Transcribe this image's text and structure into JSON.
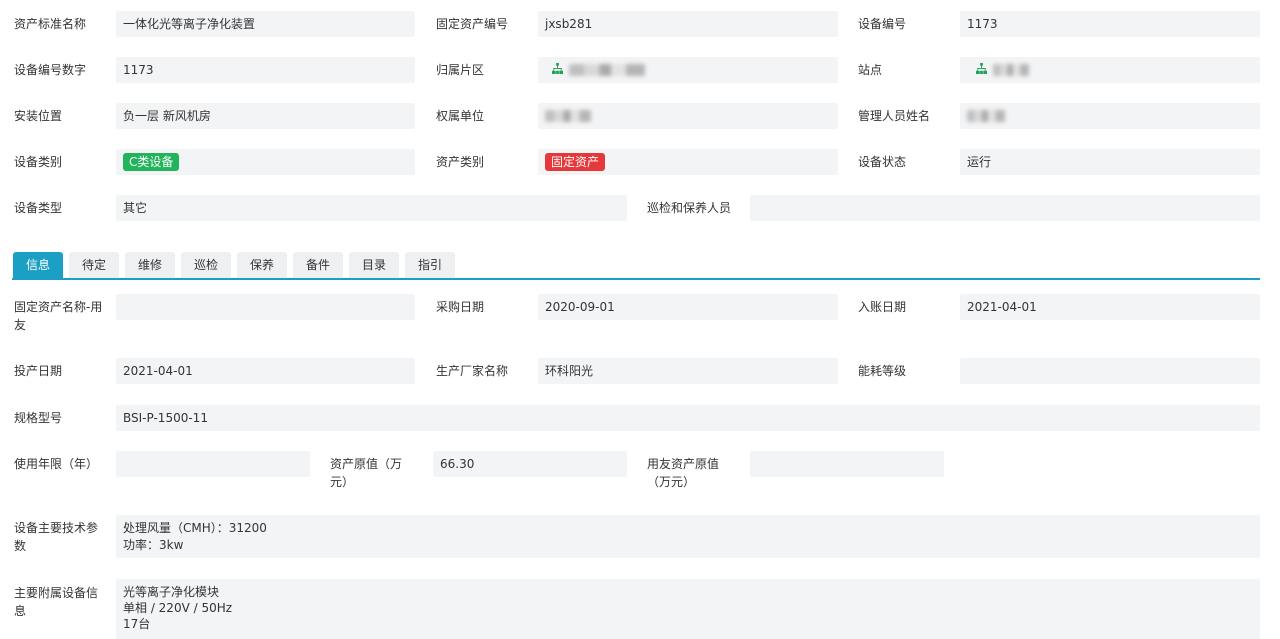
{
  "fields_top": {
    "asset_std_name_label": "资产标准名称",
    "asset_std_name": "一体化光等离子净化装置",
    "fixed_asset_no_label": "固定资产编号",
    "fixed_asset_no": "jxsb281",
    "device_no_label": "设备编号",
    "device_no": "1173",
    "device_no_num_label": "设备编号数字",
    "device_no_num": "1173",
    "area_label": "归属片区",
    "site_label": "站点",
    "install_loc_label": "安装位置",
    "install_loc": "负一层 新风机房",
    "owner_unit_label": "权属单位",
    "manager_label": "管理人员姓名",
    "device_class_label": "设备类别",
    "device_class_tag": "C类设备",
    "asset_class_label": "资产类别",
    "asset_class_tag": "固定资产",
    "device_status_label": "设备状态",
    "device_status": "运行",
    "device_type_label": "设备类型",
    "device_type": "其它",
    "inspect_staff_label": "巡检和保养人员",
    "inspect_staff": ""
  },
  "tabs": [
    {
      "label": "信息",
      "active": true
    },
    {
      "label": "待定"
    },
    {
      "label": "维修"
    },
    {
      "label": "巡检"
    },
    {
      "label": "保养"
    },
    {
      "label": "备件"
    },
    {
      "label": "目录"
    },
    {
      "label": "指引"
    }
  ],
  "info": {
    "fixed_asset_name_yy_label": "固定资产名称-用友",
    "fixed_asset_name_yy": "",
    "purchase_date_label": "采购日期",
    "purchase_date": "2020-09-01",
    "entry_date_label": "入账日期",
    "entry_date": "2021-04-01",
    "production_date_label": "投产日期",
    "production_date": "2021-04-01",
    "manufacturer_label": "生产厂家名称",
    "manufacturer": "环科阳光",
    "energy_level_label": "能耗等级",
    "energy_level": "",
    "spec_model_label": "规格型号",
    "spec_model": "BSI-P-1500-11",
    "service_life_label": "使用年限（年）",
    "service_life": "",
    "original_value_label": "资产原值（万元）",
    "original_value": "66.30",
    "yy_original_value_label": "用友资产原值（万元）",
    "yy_original_value": "",
    "tech_params_label": "设备主要技术参数",
    "tech_params": "处理风量（CMH）：31200\n功率：3kw",
    "accessory_label": "主要附属设备信息",
    "accessory": "光等离子净化模块\n单相 / 220V / 50Hz\n17台"
  },
  "colors": {
    "accent": "#1b9fc5",
    "field_bg": "#f3f4f6",
    "tag_green": "#21b45b",
    "tag_red": "#e5383b",
    "org_icon": "#21a05a"
  },
  "icons": {
    "area_icon": "org-tree-icon",
    "site_icon": "org-tree-icon"
  }
}
